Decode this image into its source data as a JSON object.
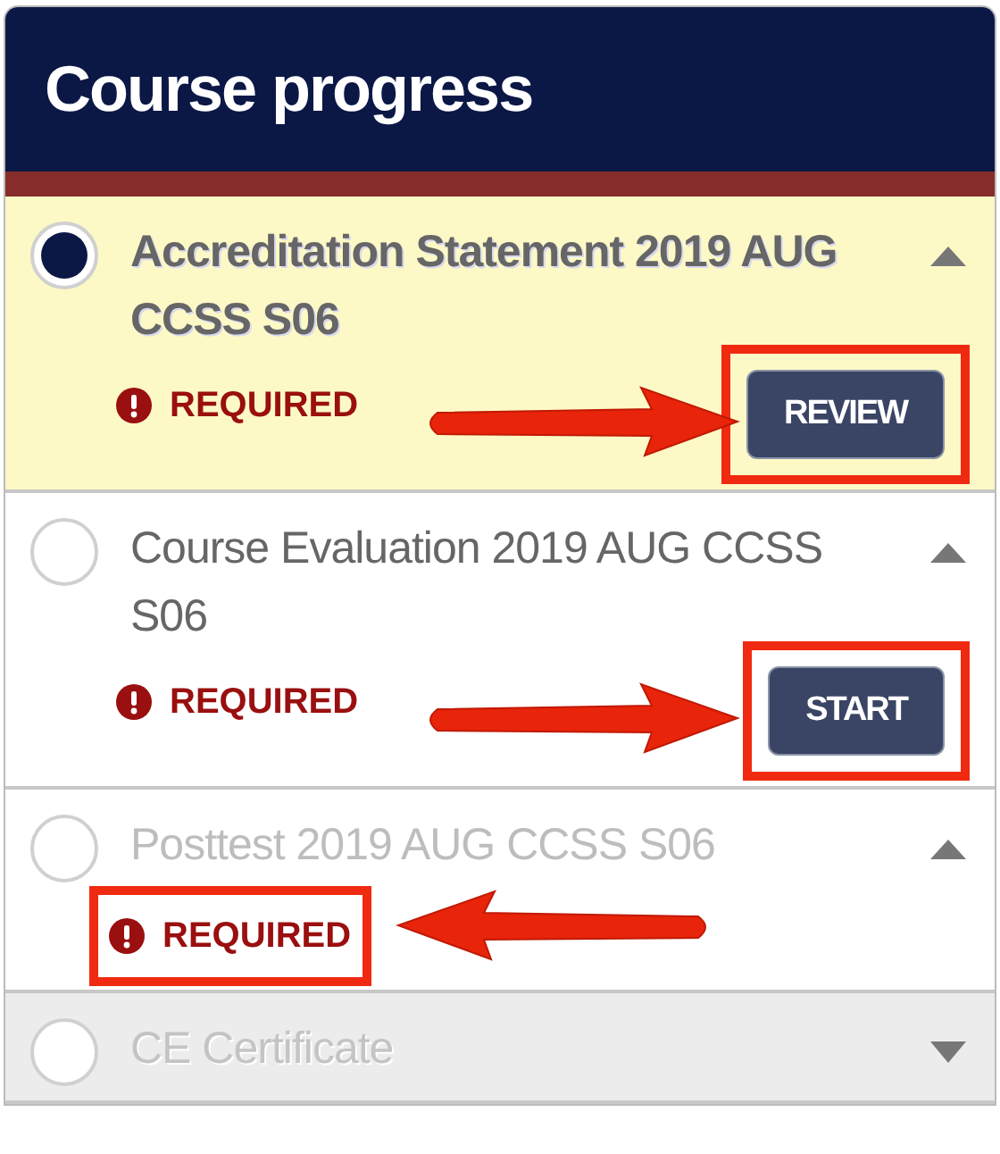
{
  "panel": {
    "title": "Course progress"
  },
  "items": [
    {
      "title": "Accreditation Statement 2019 AUG CCSS S06",
      "selected": true,
      "locked": false,
      "disabled": false,
      "expanded": true,
      "status": "REQUIRED",
      "status_highlighted": false,
      "action": "REVIEW",
      "action_highlighted": true
    },
    {
      "title": "Course Evaluation 2019 AUG CCSS S06",
      "selected": false,
      "locked": false,
      "disabled": false,
      "expanded": true,
      "status": "REQUIRED",
      "status_highlighted": false,
      "action": "START",
      "action_highlighted": true
    },
    {
      "title": "Posttest 2019 AUG CCSS S06",
      "selected": false,
      "locked": true,
      "disabled": false,
      "expanded": true,
      "status": "REQUIRED",
      "status_highlighted": true
    },
    {
      "title": "CE Certificate",
      "selected": false,
      "locked": false,
      "disabled": true,
      "expanded": false
    }
  ]
}
